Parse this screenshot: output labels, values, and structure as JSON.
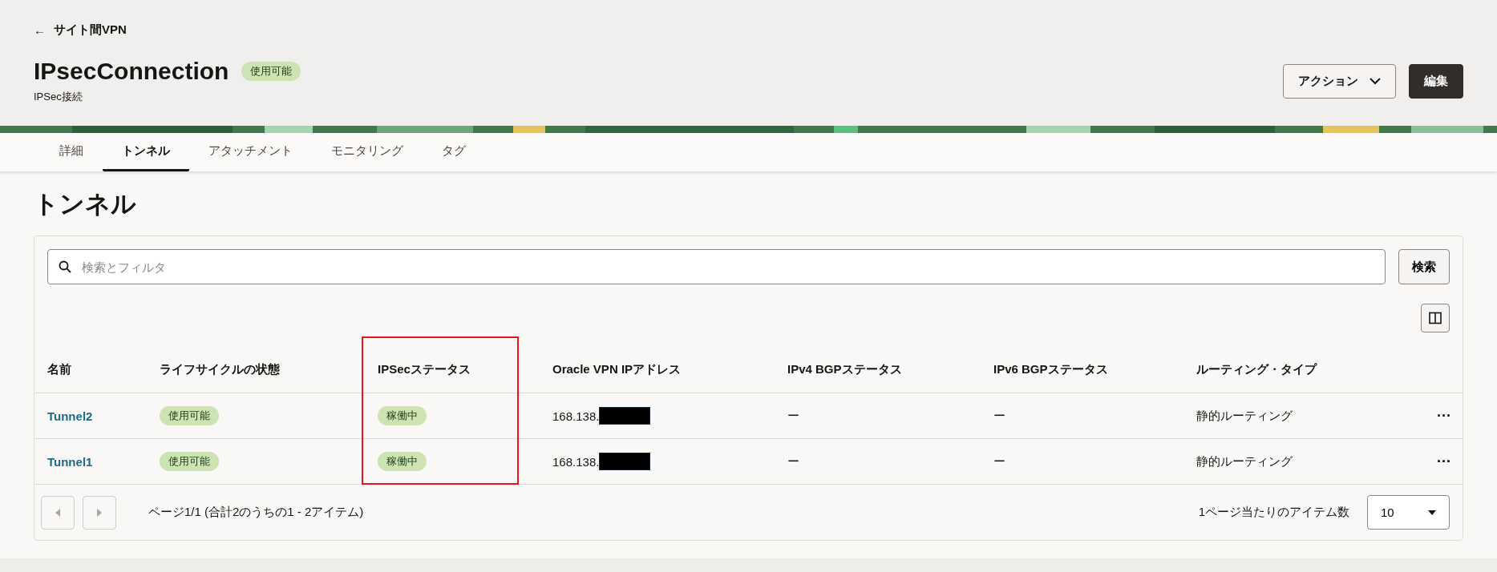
{
  "breadcrumb": {
    "icon": "←",
    "label": "サイト間VPN"
  },
  "header": {
    "title": "IPsecConnection",
    "status": "使用可能",
    "subtitle": "IPSec接続",
    "actions": [
      {
        "label": "アクション",
        "kind": "menu"
      },
      {
        "label": "編集",
        "kind": "primary"
      }
    ]
  },
  "tabs": [
    {
      "label": "詳細",
      "selected": false
    },
    {
      "label": "トンネル",
      "selected": true
    },
    {
      "label": "アタッチメント",
      "selected": false
    },
    {
      "label": "モニタリング",
      "selected": false
    },
    {
      "label": "タグ",
      "selected": false
    }
  ],
  "section_title": "トンネル",
  "search": {
    "placeholder": "検索とフィルタ",
    "button": "検索"
  },
  "table": {
    "columns": [
      {
        "label": "名前"
      },
      {
        "label": "ライフサイクルの状態"
      },
      {
        "label": "IPSecステータス",
        "highlighted": true
      },
      {
        "label": "Oracle VPN IPアドレス"
      },
      {
        "label": "IPv4 BGPステータス"
      },
      {
        "label": "IPv6 BGPステータス"
      },
      {
        "label": "ルーティング・タイプ"
      }
    ],
    "rows": [
      {
        "name": "Tunnel2",
        "lifecycle": "使用可能",
        "ipsec": "稼働中",
        "ip": "168.138.",
        "ip_redacted": true,
        "ipv4_bgp": "ー",
        "ipv6_bgp": "ー",
        "routing": "静的ルーティング",
        "menu": "···"
      },
      {
        "name": "Tunnel1",
        "lifecycle": "使用可能",
        "ipsec": "稼働中",
        "ip": "168.138.",
        "ip_redacted": true,
        "ipv4_bgp": "ー",
        "ipv6_bgp": "ー",
        "routing": "静的ルーティング",
        "menu": "···"
      }
    ]
  },
  "pagination": {
    "prev_disabled": true,
    "next_disabled": true,
    "summary": "ページ1/1 (合計2のうちの1 - 2アイテム)",
    "per_page_label": "1ページ当たりのアイテム数",
    "per_page": "10"
  }
}
